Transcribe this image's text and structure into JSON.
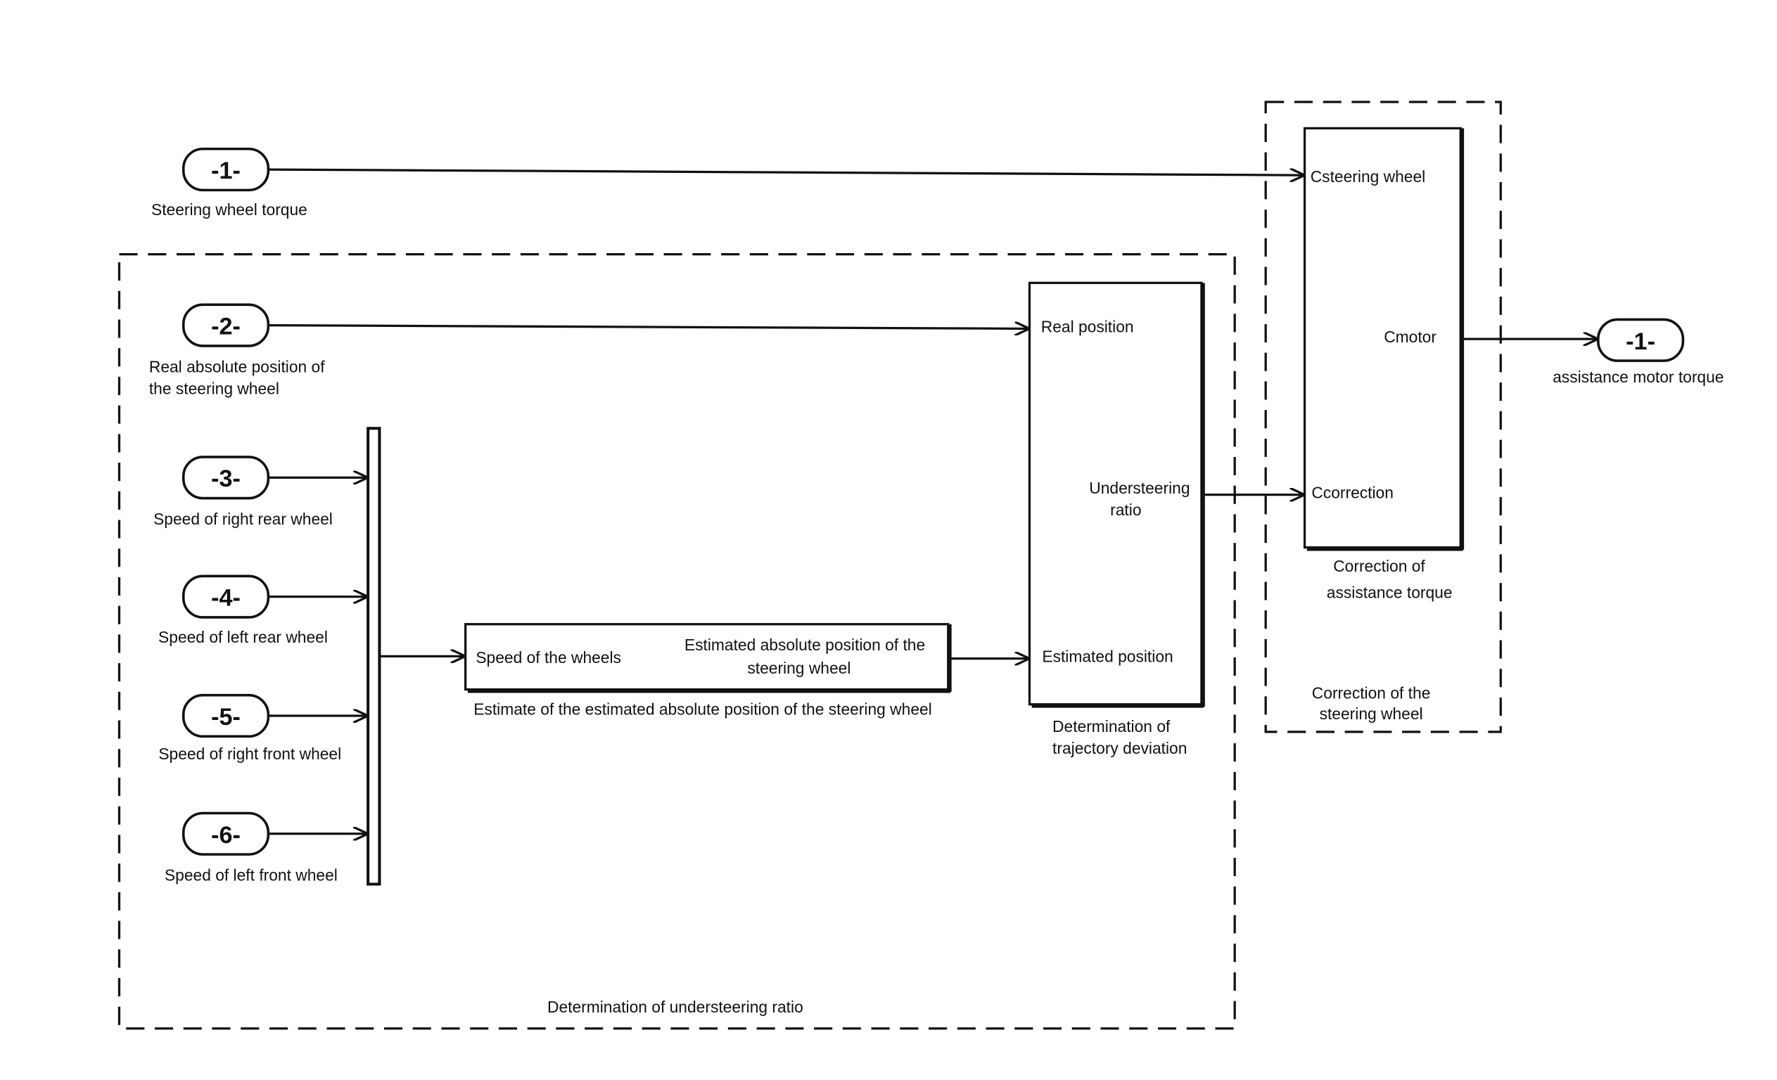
{
  "diagram": {
    "inputs": [
      {
        "id": "in1",
        "number": "-1-",
        "label_lines": [
          "Steering wheel torque"
        ]
      },
      {
        "id": "in2",
        "number": "-2-",
        "label_lines": [
          "Real absolute position of",
          "the steering wheel"
        ]
      },
      {
        "id": "in3",
        "number": "-3-",
        "label_lines": [
          "Speed of right rear wheel"
        ]
      },
      {
        "id": "in4",
        "number": "-4-",
        "label_lines": [
          "Speed of left rear wheel"
        ]
      },
      {
        "id": "in5",
        "number": "-5-",
        "label_lines": [
          "Speed of right front wheel"
        ]
      },
      {
        "id": "in6",
        "number": "-6-",
        "label_lines": [
          "Speed of left front wheel"
        ]
      }
    ],
    "outputs": [
      {
        "id": "out1",
        "number": "-1-",
        "label_lines": [
          "assistance motor torque"
        ]
      }
    ],
    "blocks": {
      "estimate": {
        "in_port": "Speed of the wheels",
        "out_port_lines": [
          "Estimated absolute position of the",
          "steering wheel"
        ],
        "caption": "Estimate of the estimated absolute position of the steering wheel"
      },
      "trajectory": {
        "in_ports": [
          "Real position",
          "Estimated position"
        ],
        "out_port_lines": [
          "Understeering",
          "ratio"
        ],
        "caption_lines": [
          "Determination of",
          "trajectory deviation"
        ]
      },
      "correction": {
        "in_ports": [
          "Csteering wheel",
          "Ccorrection"
        ],
        "out_port": "Cmotor",
        "caption_lines": [
          "Correction of",
          "assistance torque"
        ]
      }
    },
    "subsystems": {
      "understeering": {
        "caption": "Determination of understeering ratio"
      },
      "steering_correction": {
        "caption_lines": [
          "Correction of the",
          "steering wheel"
        ]
      }
    }
  }
}
